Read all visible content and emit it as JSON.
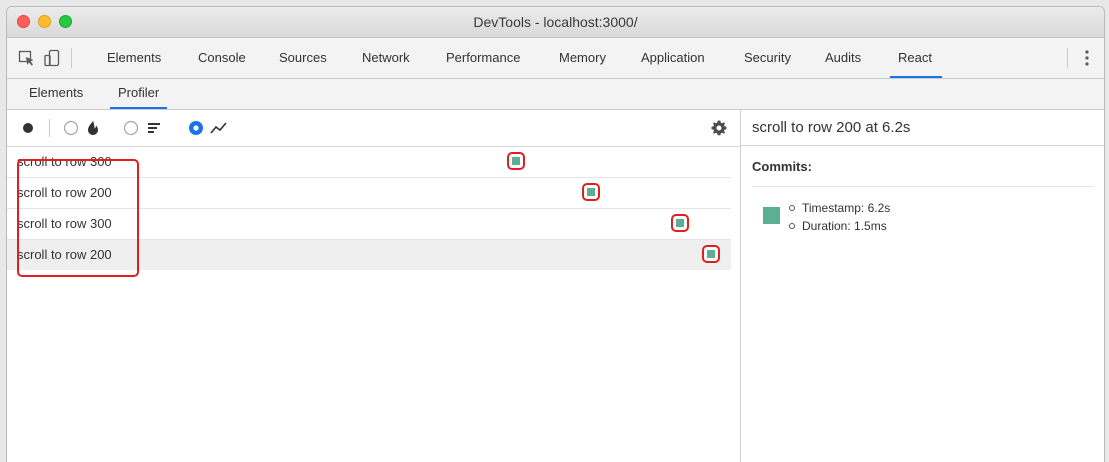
{
  "window": {
    "title": "DevTools - localhost:3000/"
  },
  "tabs": [
    {
      "label": "Elements"
    },
    {
      "label": "Console"
    },
    {
      "label": "Sources"
    },
    {
      "label": "Network"
    },
    {
      "label": "Performance"
    },
    {
      "label": "Memory"
    },
    {
      "label": "Application"
    },
    {
      "label": "Security"
    },
    {
      "label": "Audits"
    },
    {
      "label": "React",
      "active": true
    }
  ],
  "subtabs": [
    {
      "label": "Elements"
    },
    {
      "label": "Profiler",
      "active": true
    }
  ],
  "profiler": {
    "toolbar": {
      "record_icon": "record-dot-icon",
      "views": [
        {
          "name": "flamegraph",
          "icon": "flame-icon",
          "selected": false
        },
        {
          "name": "ranked",
          "icon": "ranked-bars-icon",
          "selected": false
        },
        {
          "name": "interactions",
          "icon": "interactions-icon",
          "selected": true
        }
      ],
      "settings_icon": "gear-icon"
    },
    "interactions": [
      {
        "label": "scroll to row 300",
        "commit_progress": 0.64
      },
      {
        "label": "scroll to row 200",
        "commit_progress": 0.77
      },
      {
        "label": "scroll to row 300",
        "commit_progress": 0.925
      },
      {
        "label": "scroll to row 200",
        "commit_progress": 0.98,
        "selected": true
      }
    ]
  },
  "sidebar": {
    "header": "scroll to row 200 at 6.2s",
    "commits_label": "Commits:",
    "timestamp": "Timestamp: 6.2s",
    "duration": "Duration: 1.5ms"
  },
  "colors": {
    "commit": "#5daf94",
    "highlight": "#e02020",
    "accent": "#1a73e8"
  }
}
